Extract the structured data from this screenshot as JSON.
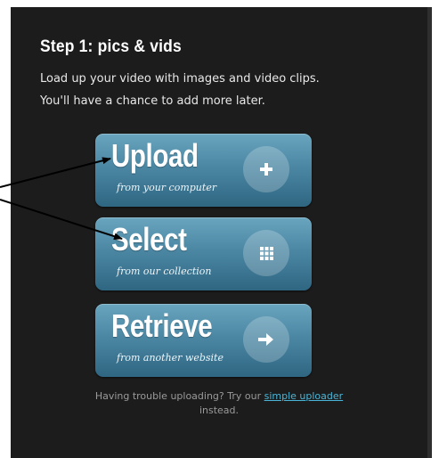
{
  "step": {
    "title": "Step 1: pics & vids",
    "description_line1": "Load up your video with images and video clips.",
    "description_line2": "You'll have a chance to add more later."
  },
  "buttons": [
    {
      "label": "Upload",
      "sublabel": "from your computer",
      "icon": "plus-icon"
    },
    {
      "label": "Select",
      "sublabel": "from our collection",
      "icon": "grid-icon"
    },
    {
      "label": "Retrieve",
      "sublabel": "from another website",
      "icon": "arrow-right-icon"
    }
  ],
  "footer": {
    "text_before": "Having trouble uploading? Try our ",
    "link_text": "simple uploader",
    "text_after": "instead."
  },
  "colors": {
    "panel_bg": "#1c1c1c",
    "button_top": "#6aa5bf",
    "button_bottom": "#2f6682",
    "link": "#49b6d9"
  }
}
